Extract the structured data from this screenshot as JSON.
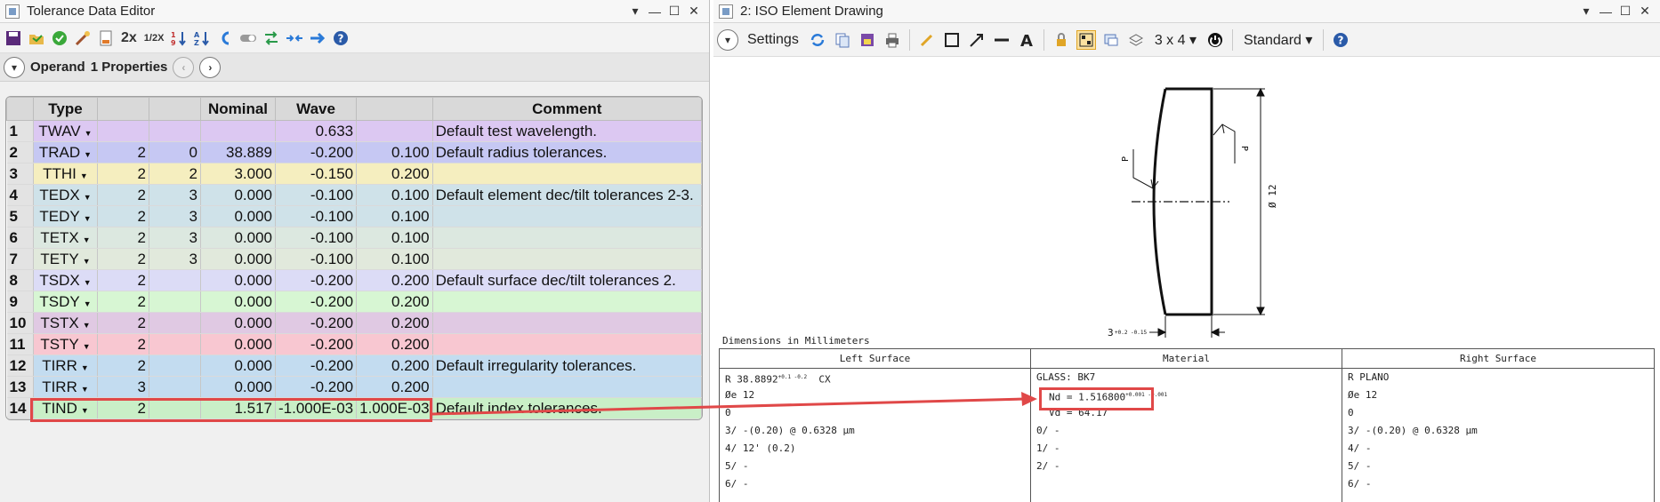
{
  "left": {
    "title": "Tolerance Data Editor",
    "toolbar": {
      "zoom2x": "2x",
      "zoomhalf": "1/2X"
    },
    "operand": {
      "label": "Operand",
      "props": "1 Properties"
    },
    "columns": [
      "Type",
      "",
      "",
      "Nominal",
      "Wave",
      "",
      "Comment"
    ],
    "rows": [
      {
        "n": "1",
        "type": "TWAV",
        "a": "",
        "b": "",
        "nom": "",
        "wave": "0.633",
        "c": "",
        "comment": "Default test wavelength.",
        "bg": "#dcc8f2"
      },
      {
        "n": "2",
        "type": "TRAD",
        "a": "2",
        "b": "0",
        "nom": "38.889",
        "wave": "-0.200",
        "c": "0.100",
        "comment": "Default radius tolerances.",
        "bg": "#c6c8f3"
      },
      {
        "n": "3",
        "type": "TTHI",
        "a": "2",
        "b": "2",
        "nom": "3.000",
        "wave": "-0.150",
        "c": "0.200",
        "comment": "",
        "bg": "#f5eebf"
      },
      {
        "n": "4",
        "type": "TEDX",
        "a": "2",
        "b": "3",
        "nom": "0.000",
        "wave": "-0.100",
        "c": "0.100",
        "comment": "Default element dec/tilt tolerances 2-3.",
        "bg": "#cfe2e9"
      },
      {
        "n": "5",
        "type": "TEDY",
        "a": "2",
        "b": "3",
        "nom": "0.000",
        "wave": "-0.100",
        "c": "0.100",
        "comment": "",
        "bg": "#cfe2e9"
      },
      {
        "n": "6",
        "type": "TETX",
        "a": "2",
        "b": "3",
        "nom": "0.000",
        "wave": "-0.100",
        "c": "0.100",
        "comment": "",
        "bg": "#dce8e0"
      },
      {
        "n": "7",
        "type": "TETY",
        "a": "2",
        "b": "3",
        "nom": "0.000",
        "wave": "-0.100",
        "c": "0.100",
        "comment": "",
        "bg": "#e1e9dc"
      },
      {
        "n": "8",
        "type": "TSDX",
        "a": "2",
        "b": "",
        "nom": "0.000",
        "wave": "-0.200",
        "c": "0.200",
        "comment": "Default surface dec/tilt tolerances 2.",
        "bg": "#dcdcf6"
      },
      {
        "n": "9",
        "type": "TSDY",
        "a": "2",
        "b": "",
        "nom": "0.000",
        "wave": "-0.200",
        "c": "0.200",
        "comment": "",
        "bg": "#d7f6d3"
      },
      {
        "n": "10",
        "type": "TSTX",
        "a": "2",
        "b": "",
        "nom": "0.000",
        "wave": "-0.200",
        "c": "0.200",
        "comment": "",
        "bg": "#e0c9e3"
      },
      {
        "n": "11",
        "type": "TSTY",
        "a": "2",
        "b": "",
        "nom": "0.000",
        "wave": "-0.200",
        "c": "0.200",
        "comment": "",
        "bg": "#f8c7d1"
      },
      {
        "n": "12",
        "type": "TIRR",
        "a": "2",
        "b": "",
        "nom": "0.000",
        "wave": "-0.200",
        "c": "0.200",
        "comment": "Default irregularity tolerances.",
        "bg": "#c3dcf0"
      },
      {
        "n": "13",
        "type": "TIRR",
        "a": "3",
        "b": "",
        "nom": "0.000",
        "wave": "-0.200",
        "c": "0.200",
        "comment": "",
        "bg": "#c3dcf0"
      },
      {
        "n": "14",
        "type": "TIND",
        "a": "2",
        "b": "",
        "nom": "1.517",
        "wave": "-1.000E-03",
        "c": "1.000E-03",
        "comment": "Default index tolerances.",
        "bg": "#c9efc7"
      }
    ]
  },
  "right": {
    "title": "2: ISO Element Drawing",
    "toolbar": {
      "settings": "Settings",
      "layout": "3 x 4",
      "style": "Standard"
    },
    "drawing": {
      "p_left": "P",
      "p_right": "P",
      "diameter": "Ø 12",
      "thickness": "3",
      "thickness_tol": "+0.2 -0.15"
    },
    "dims_label": "Dimensions in Millimeters",
    "table": {
      "left": {
        "head": "Left Surface",
        "lines": [
          "R 38.8892",
          "Øe 12",
          "0",
          "3/ -(0.20) @ 0.6328 µm",
          "4/ 12' (0.2)",
          "5/ -",
          "6/ -"
        ],
        "r_tol": "+0.1 -0.2",
        "cx": "CX"
      },
      "mid": {
        "head": "Material",
        "lines": [
          "GLASS: BK7",
          "Nd = 1.516800",
          "",
          "Vd = 64.17",
          "0/ -",
          "1/ -",
          "2/ -"
        ],
        "nd_tol": "+0.001 -0.001"
      },
      "right": {
        "head": "Right Surface",
        "lines": [
          "R PLANO",
          "Øe 12",
          "0",
          "3/ -(0.20) @ 0.6328 µm",
          "4/ -",
          "5/ -",
          "6/ -"
        ]
      }
    }
  },
  "colors": {
    "highlight": "#e04848",
    "accent": "#e0a526"
  }
}
